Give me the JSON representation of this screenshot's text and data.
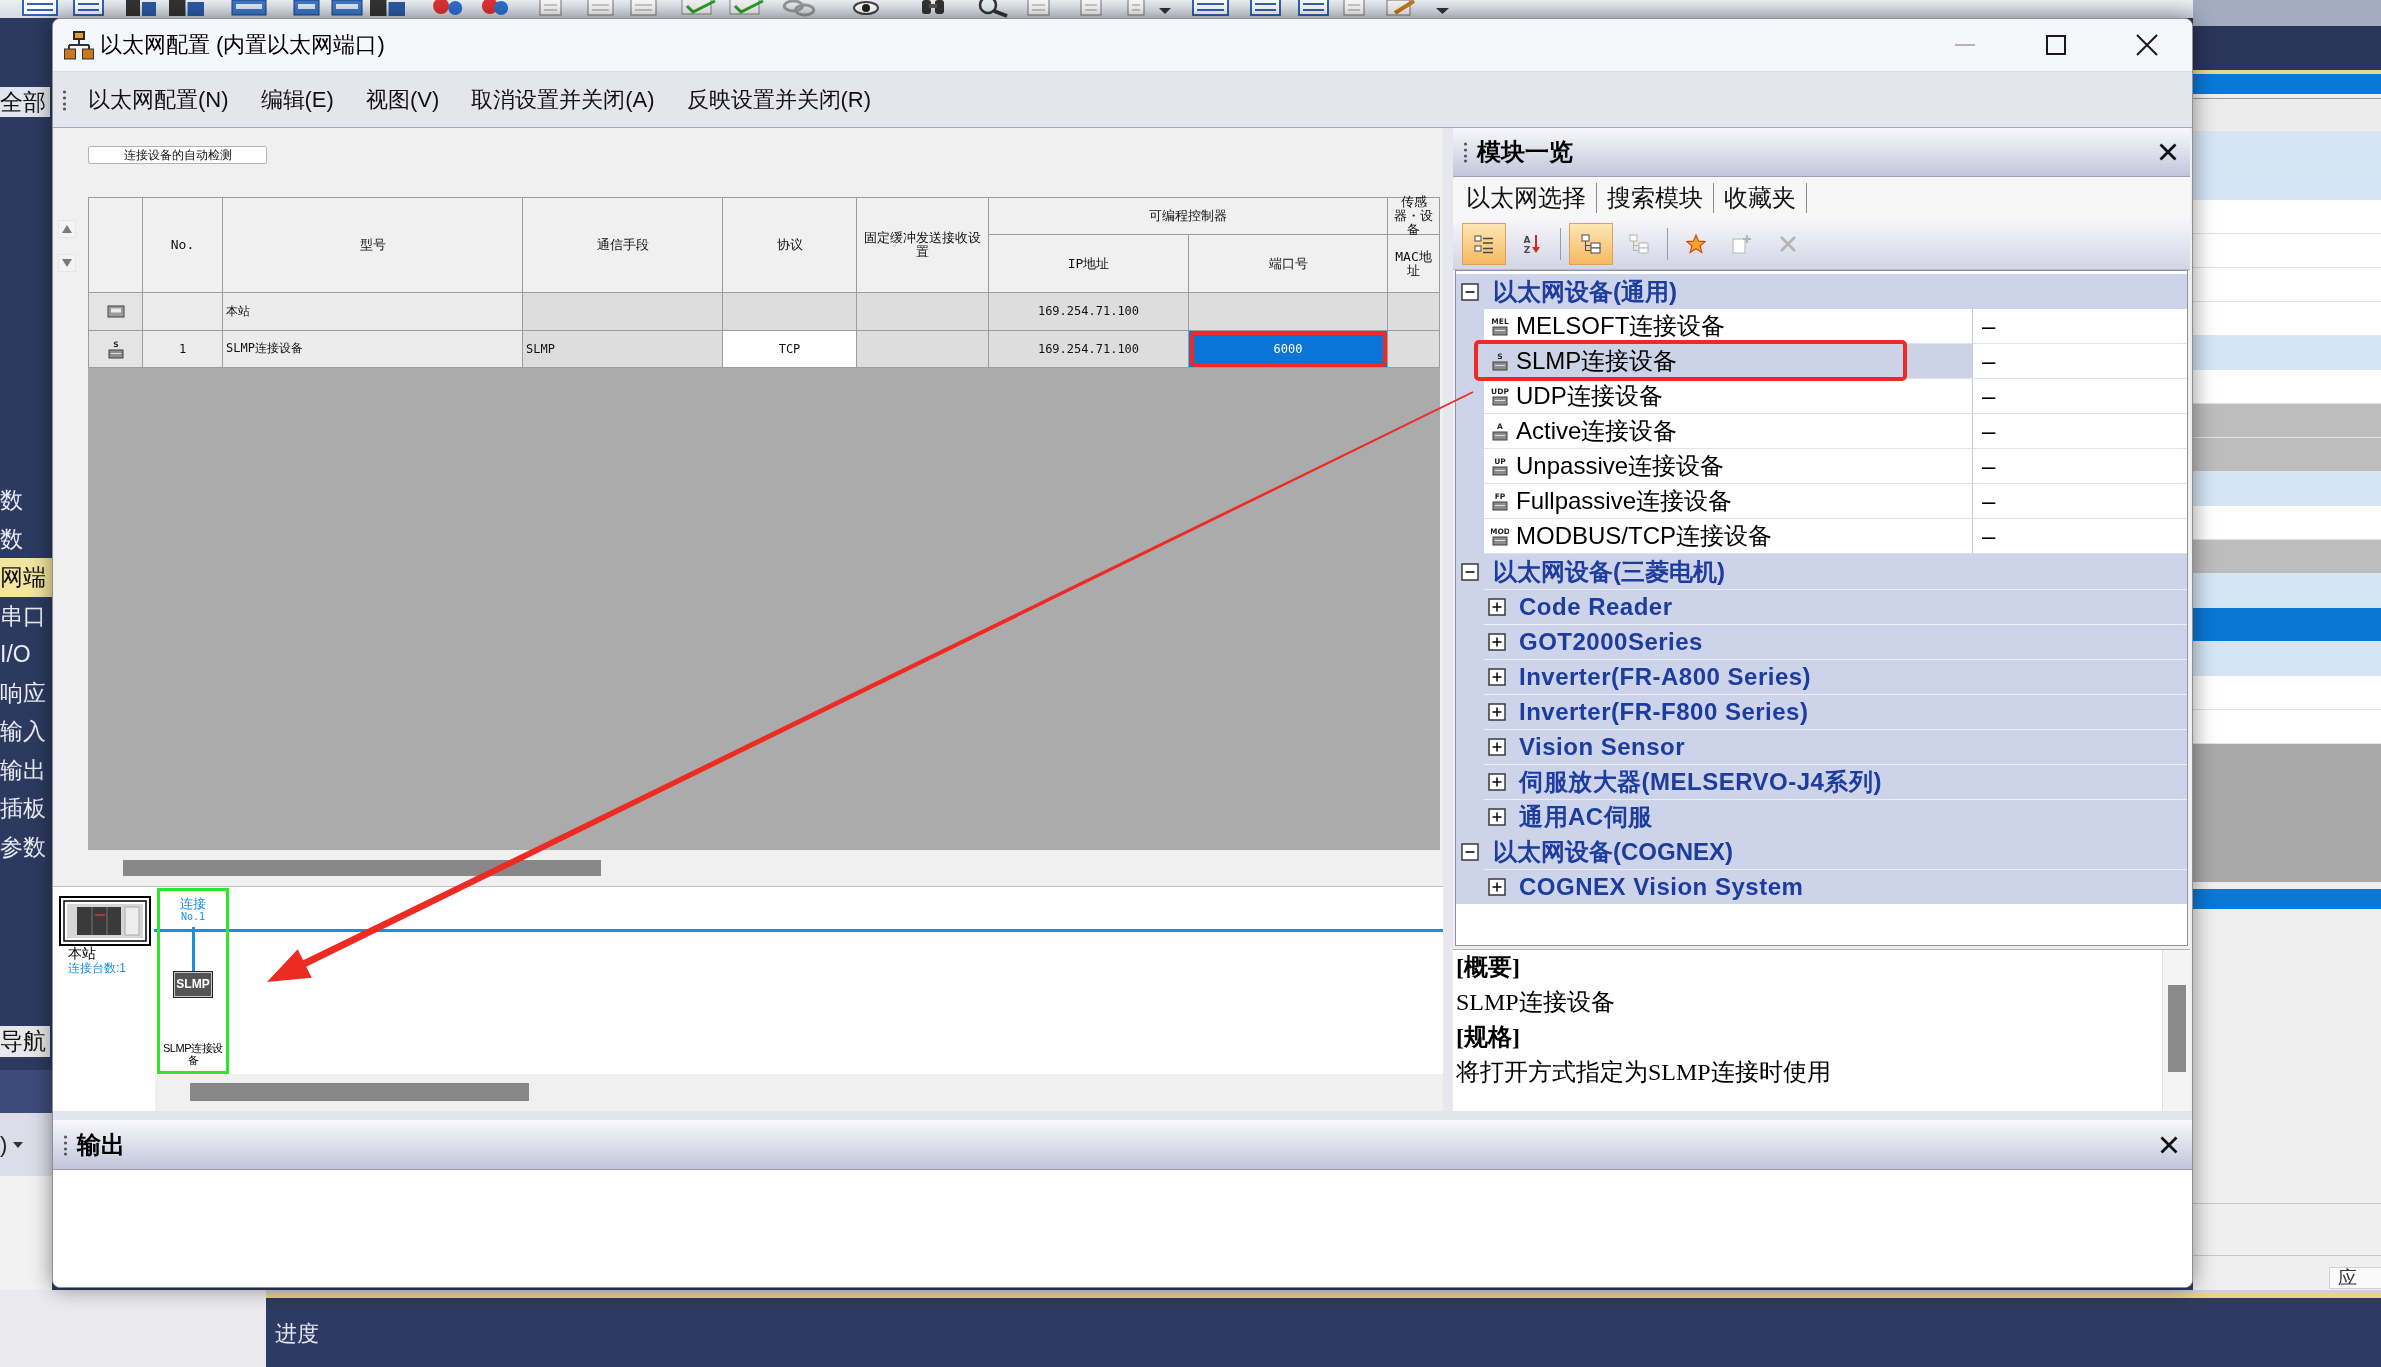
{
  "app": {
    "left_panel": {
      "tab": "全部",
      "items": [
        {
          "label": "数",
          "selected": false
        },
        {
          "label": "数",
          "selected": false
        },
        {
          "label": "网端",
          "selected": true
        },
        {
          "label": "串口",
          "selected": false
        },
        {
          "label": "I/O",
          "selected": false
        },
        {
          "label": "响应",
          "selected": false
        },
        {
          "label": "输入",
          "selected": false
        },
        {
          "label": "输出",
          "selected": false
        },
        {
          "label": "插板",
          "selected": false
        },
        {
          "label": "参数",
          "selected": false
        }
      ],
      "navigation_tab": "导航",
      "selector": ")"
    },
    "side_list": {
      "rows": [
        {
          "kind": "heading",
          "selected": false
        },
        {
          "kind": "tinted",
          "selected": false
        },
        {
          "kind": "tinted",
          "selected": false
        },
        {
          "kind": "plain",
          "selected": false
        },
        {
          "kind": "plain",
          "selected": false
        },
        {
          "kind": "plain",
          "selected": false
        },
        {
          "kind": "plain",
          "selected": false
        },
        {
          "kind": "tinted",
          "selected": false
        },
        {
          "kind": "plain",
          "selected": false
        },
        {
          "kind": "shaded",
          "selected": false
        },
        {
          "kind": "shaded",
          "selected": false
        },
        {
          "kind": "tinted",
          "selected": false
        },
        {
          "kind": "plain",
          "selected": false
        },
        {
          "kind": "shaded",
          "selected": false
        },
        {
          "kind": "tinted",
          "selected": false
        },
        {
          "kind": "plain",
          "selected": true
        },
        {
          "kind": "tinted",
          "selected": false
        },
        {
          "kind": "plain",
          "selected": false
        },
        {
          "kind": "plain",
          "selected": false
        }
      ]
    },
    "apply_button": "应",
    "progress_label": "进度"
  },
  "window": {
    "title": "以太网配置 (内置以太网端口)",
    "controls": [
      {
        "kind": "minimize",
        "disabled": true
      },
      {
        "kind": "maximize",
        "disabled": false
      },
      {
        "kind": "close",
        "disabled": false
      }
    ],
    "menu": [
      "以太网配置(N)",
      "编辑(E)",
      "视图(V)",
      "取消设置并关闭(A)",
      "反映设置并关闭(R)"
    ],
    "autodetect_button": "连接设备的自动检测",
    "table": {
      "header": [
        {
          "label": "No."
        },
        {
          "label": "型号"
        },
        {
          "label": "通信手段"
        },
        {
          "label": "协议"
        },
        {
          "label": "固定缓冲发送接收设置"
        },
        {
          "label": "可编程控制器",
          "children": [
            {
              "label": "IP地址"
            },
            {
              "label": "端口号"
            }
          ]
        },
        {
          "label": "传感器・设备",
          "children": [
            {
              "label": "MAC地址"
            }
          ]
        }
      ],
      "rows": [
        {
          "kind": "station",
          "cells": [
            {
              "editable": false,
              "selected": false
            },
            {
              "text": "本站",
              "editable": false,
              "selected": false
            },
            {
              "editable": false,
              "selected": false
            },
            {
              "editable": false,
              "selected": false
            },
            {
              "editable": false,
              "selected": false
            },
            {
              "text": "169.254.71.100",
              "editable": false,
              "selected": false
            },
            {
              "editable": false,
              "selected": false
            },
            {
              "editable": false,
              "selected": false
            }
          ]
        },
        {
          "kind": "device",
          "badge": "S",
          "cells": [
            {
              "text": "1",
              "editable": false,
              "selected": false
            },
            {
              "text": "SLMP连接设备",
              "editable": false,
              "selected": false
            },
            {
              "text": "SLMP",
              "editable": false,
              "selected": false
            },
            {
              "text": "TCP",
              "editable": true,
              "selected": false
            },
            {
              "editable": false,
              "selected": false
            },
            {
              "text": "169.254.71.100",
              "editable": false,
              "selected": false
            },
            {
              "text": "6000",
              "editable": false,
              "selected": true
            },
            {
              "editable": false,
              "selected": false
            }
          ]
        }
      ]
    },
    "diagram": {
      "station": {
        "label": "本站",
        "count": "连接台数:1"
      },
      "nodes": [
        {
          "connection": "连接",
          "number": "No.1",
          "badge": "SLMP",
          "label": "SLMP连接设备",
          "selected": true
        }
      ]
    },
    "module_list": {
      "title": "模块一览",
      "tabs": [
        "以太网选择",
        "搜索模块",
        "收藏夹"
      ],
      "toolbar": [
        {
          "kind": "group",
          "selected": true,
          "disabled": false
        },
        {
          "kind": "sort",
          "letters": [
            "A",
            "Z"
          ],
          "selected": false,
          "disabled": false
        },
        {
          "kind": "expand",
          "selected": true,
          "disabled": false
        },
        {
          "kind": "collapse",
          "selected": false,
          "disabled": true
        },
        {
          "kind": "favorite",
          "selected": false,
          "disabled": false
        },
        {
          "kind": "add",
          "selected": false,
          "disabled": true
        },
        {
          "kind": "remove",
          "selected": false,
          "disabled": true
        }
      ],
      "tree": [
        {
          "kind": "group",
          "label": "以太网设备(通用)",
          "expanded": true,
          "selected": false,
          "children": [
            {
              "kind": "device",
              "label": "MELSOFT连接设备",
              "badge": "MEL",
              "value": "–",
              "selected": false
            },
            {
              "kind": "device",
              "label": "SLMP连接设备",
              "badge": "S",
              "value": "–",
              "selected": true
            },
            {
              "kind": "device",
              "label": "UDP连接设备",
              "badge": "UDP",
              "value": "–",
              "selected": false
            },
            {
              "kind": "device",
              "label": "Active连接设备",
              "badge": "A",
              "value": "–",
              "selected": false
            },
            {
              "kind": "device",
              "label": "Unpassive连接设备",
              "badge": "UP",
              "value": "–",
              "selected": false
            },
            {
              "kind": "device",
              "label": "Fullpassive连接设备",
              "badge": "FP",
              "value": "–",
              "selected": false
            },
            {
              "kind": "device",
              "label": "MODBUS/TCP连接设备",
              "badge": "MOD",
              "value": "–",
              "selected": false
            }
          ]
        },
        {
          "kind": "group",
          "label": "以太网设备(三菱电机)",
          "expanded": true,
          "selected": false,
          "children": [
            {
              "kind": "category",
              "label": "Code Reader",
              "expanded": false,
              "selected": false
            },
            {
              "kind": "category",
              "label": "GOT2000Series",
              "expanded": false,
              "selected": false
            },
            {
              "kind": "category",
              "label": "Inverter(FR-A800 Series)",
              "expanded": false,
              "selected": false
            },
            {
              "kind": "category",
              "label": "Inverter(FR-F800 Series)",
              "expanded": false,
              "selected": false
            },
            {
              "kind": "category",
              "label": "Vision Sensor",
              "expanded": false,
              "selected": false
            },
            {
              "kind": "category",
              "label": "伺服放大器(MELSERVO-J4系列)",
              "expanded": false,
              "selected": false
            },
            {
              "kind": "category",
              "label": "通用AC伺服",
              "expanded": false,
              "selected": false
            }
          ]
        },
        {
          "kind": "group",
          "label": "以太网设备(COGNEX)",
          "expanded": true,
          "selected": false,
          "children": [
            {
              "kind": "category",
              "label": "COGNEX Vision System",
              "expanded": false,
              "selected": false
            }
          ]
        }
      ],
      "description": [
        {
          "kind": "heading",
          "text": "[概要]"
        },
        {
          "kind": "text",
          "text": "SLMP连接设备"
        },
        {
          "kind": "heading",
          "text": "[规格]"
        },
        {
          "kind": "text",
          "text": "将打开方式指定为SLMP连接时使用"
        }
      ]
    },
    "output": {
      "title": "输出"
    }
  },
  "annotations": [
    {
      "kind": "frame"
    },
    {
      "kind": "frame"
    },
    {
      "kind": "arrow"
    }
  ]
}
